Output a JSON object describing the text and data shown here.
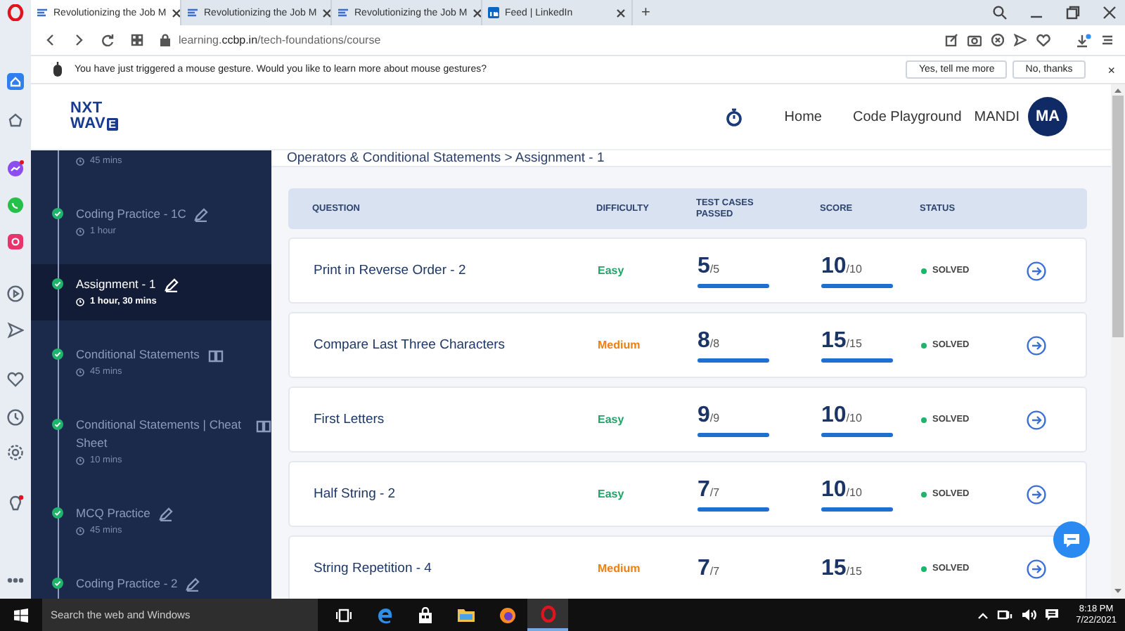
{
  "browser": {
    "tabs": [
      {
        "title": "Revolutionizing the Job M",
        "selected": true
      },
      {
        "title": "Revolutionizing the Job M",
        "selected": false
      },
      {
        "title": "Revolutionizing the Job M",
        "selected": false
      },
      {
        "title": "Feed | LinkedIn",
        "selected": false
      }
    ],
    "new_tab": "+",
    "url": "learning.**ccbp.in**/tech-foundations/course"
  },
  "infobar": {
    "message": "You have just triggered a mouse gesture. Would you like to learn more about mouse gestures?",
    "buttons": [
      "Yes, tell me more",
      "No, thanks"
    ],
    "close": "×"
  },
  "header": {
    "logo": {
      "top": "NXT",
      "bottom": "WAV",
      "badge": "E"
    },
    "nav": [
      "Home",
      "Code Playground"
    ],
    "user": "MANDI",
    "avatar": "MA"
  },
  "sidebar": {
    "items": [
      {
        "duration": "45 mins",
        "selected": false
      },
      {
        "title": "Coding Practice - 1C",
        "kind": "practice",
        "duration": "1 hour",
        "done": true,
        "selected": false
      },
      {
        "title": "Assignment - 1",
        "kind": "practice",
        "duration": "1 hour, 30 mins",
        "done": true,
        "selected": true
      },
      {
        "title": "Conditional Statements",
        "kind": "reading",
        "duration": "45 mins",
        "done": true,
        "selected": false
      },
      {
        "title": "Conditional Statements | Cheat Sheet",
        "kind": "reading",
        "duration": "10 mins",
        "done": true,
        "selected": false
      },
      {
        "title": "MCQ Practice",
        "kind": "practice",
        "duration": "45 mins",
        "done": true,
        "selected": false
      },
      {
        "title": "Coding Practice - 2",
        "kind": "practice",
        "done": true,
        "selected": false
      }
    ]
  },
  "breadcrumb": "Operators & Conditional Statements > Assignment - 1",
  "table": {
    "columns": [
      "QUESTION",
      "DIFFICULTY",
      "TEST CASES PASSED",
      "SCORE",
      "STATUS"
    ],
    "rows": [
      {
        "question": "Print in Reverse Order - 2",
        "difficulty": {
          "label": "Easy",
          "kind": "easy"
        },
        "tests": {
          "value": "5",
          "total": "/5",
          "level": 1
        },
        "score": {
          "value": "10",
          "total": "/10",
          "level": 1
        },
        "status": {
          "label": "SOLVED",
          "color": "#1fb36b"
        }
      },
      {
        "question": "Compare Last Three Characters",
        "difficulty": {
          "label": "Medium",
          "kind": "medium"
        },
        "tests": {
          "value": "8",
          "total": "/8",
          "level": 1
        },
        "score": {
          "value": "15",
          "total": "/15",
          "level": 1
        },
        "status": {
          "label": "SOLVED",
          "color": "#1fb36b"
        }
      },
      {
        "question": "First Letters",
        "difficulty": {
          "label": "Easy",
          "kind": "easy"
        },
        "tests": {
          "value": "9",
          "total": "/9",
          "level": 1
        },
        "score": {
          "value": "10",
          "total": "/10",
          "level": 1
        },
        "status": {
          "label": "SOLVED",
          "color": "#1fb36b"
        }
      },
      {
        "question": "Half String - 2",
        "difficulty": {
          "label": "Easy",
          "kind": "easy"
        },
        "tests": {
          "value": "7",
          "total": "/7",
          "level": 1
        },
        "score": {
          "value": "10",
          "total": "/10",
          "level": 1
        },
        "status": {
          "label": "SOLVED",
          "color": "#1fb36b"
        }
      },
      {
        "question": "String Repetition - 4",
        "difficulty": {
          "label": "Medium",
          "kind": "medium"
        },
        "tests": {
          "value": "7",
          "total": "/7"
        },
        "score": {
          "value": "15",
          "total": "/15"
        },
        "status": {
          "label": "SOLVED",
          "color": "#1fb36b"
        }
      }
    ]
  },
  "taskbar": {
    "search": "Search the web and Windows",
    "time": "8:18 PM",
    "date": "7/22/2021"
  }
}
